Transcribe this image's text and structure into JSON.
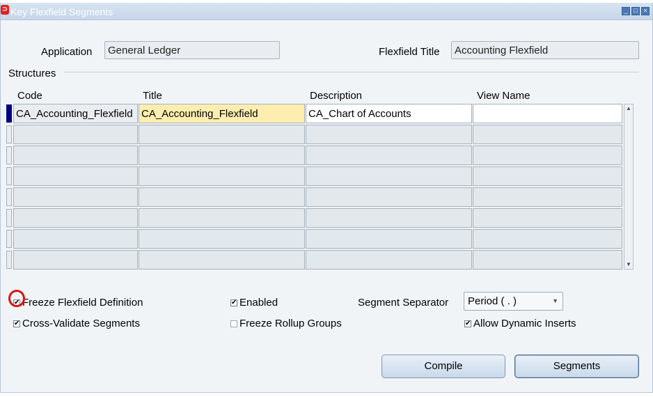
{
  "window": {
    "title": "Key Flexfield Segments"
  },
  "header": {
    "application_label": "Application",
    "application_value": "General Ledger",
    "flexfield_title_label": "Flexfield Title",
    "flexfield_title_value": "Accounting Flexfield"
  },
  "structures": {
    "section_label": "Structures",
    "columns": [
      "Code",
      "Title",
      "Description",
      "View Name"
    ],
    "rows": [
      {
        "code": "CA_Accounting_Flexfield",
        "title": "CA_Accounting_Flexfield",
        "description": "CA_Chart of Accounts",
        "view_name": ""
      },
      {
        "code": "",
        "title": "",
        "description": "",
        "view_name": ""
      },
      {
        "code": "",
        "title": "",
        "description": "",
        "view_name": ""
      },
      {
        "code": "",
        "title": "",
        "description": "",
        "view_name": ""
      },
      {
        "code": "",
        "title": "",
        "description": "",
        "view_name": ""
      },
      {
        "code": "",
        "title": "",
        "description": "",
        "view_name": ""
      },
      {
        "code": "",
        "title": "",
        "description": "",
        "view_name": ""
      },
      {
        "code": "",
        "title": "",
        "description": "",
        "view_name": ""
      }
    ]
  },
  "options": {
    "freeze_flexfield_definition": {
      "label": "Freeze Flexfield Definition",
      "checked": true
    },
    "enabled": {
      "label": "Enabled",
      "checked": true
    },
    "cross_validate_segments": {
      "label": "Cross-Validate Segments",
      "checked": true
    },
    "freeze_rollup_groups": {
      "label": "Freeze Rollup Groups",
      "checked": false
    },
    "allow_dynamic_inserts": {
      "label": "Allow Dynamic Inserts",
      "checked": true
    },
    "segment_separator_label": "Segment Separator",
    "segment_separator_value": "Period ( . )"
  },
  "buttons": {
    "compile": "Compile",
    "segments": "Segments"
  },
  "colors": {
    "active_row_marker": "#000080",
    "highlight_circle": "#e01010",
    "title_cell": "#fdeeb0"
  }
}
